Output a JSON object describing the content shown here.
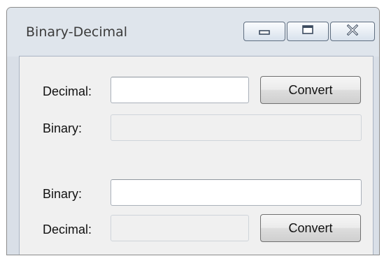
{
  "window": {
    "title": "Binary-Decimal",
    "caption_buttons": [
      {
        "icon": "minimize-icon"
      },
      {
        "icon": "maximize-icon"
      },
      {
        "icon": "close-icon"
      }
    ]
  },
  "decimal_to_binary": {
    "input_label": "Decimal:",
    "input_value": "",
    "convert_label": "Convert",
    "output_label": "Binary:",
    "output_value": ""
  },
  "binary_to_decimal": {
    "input_label": "Binary:",
    "input_value": "",
    "output_label": "Decimal:",
    "output_value": "",
    "convert_label": "Convert"
  },
  "colors": {
    "titlebar": "#dfe5ec",
    "client_bg": "#f0f0f0",
    "caption_button_border": "#5f6e80"
  }
}
